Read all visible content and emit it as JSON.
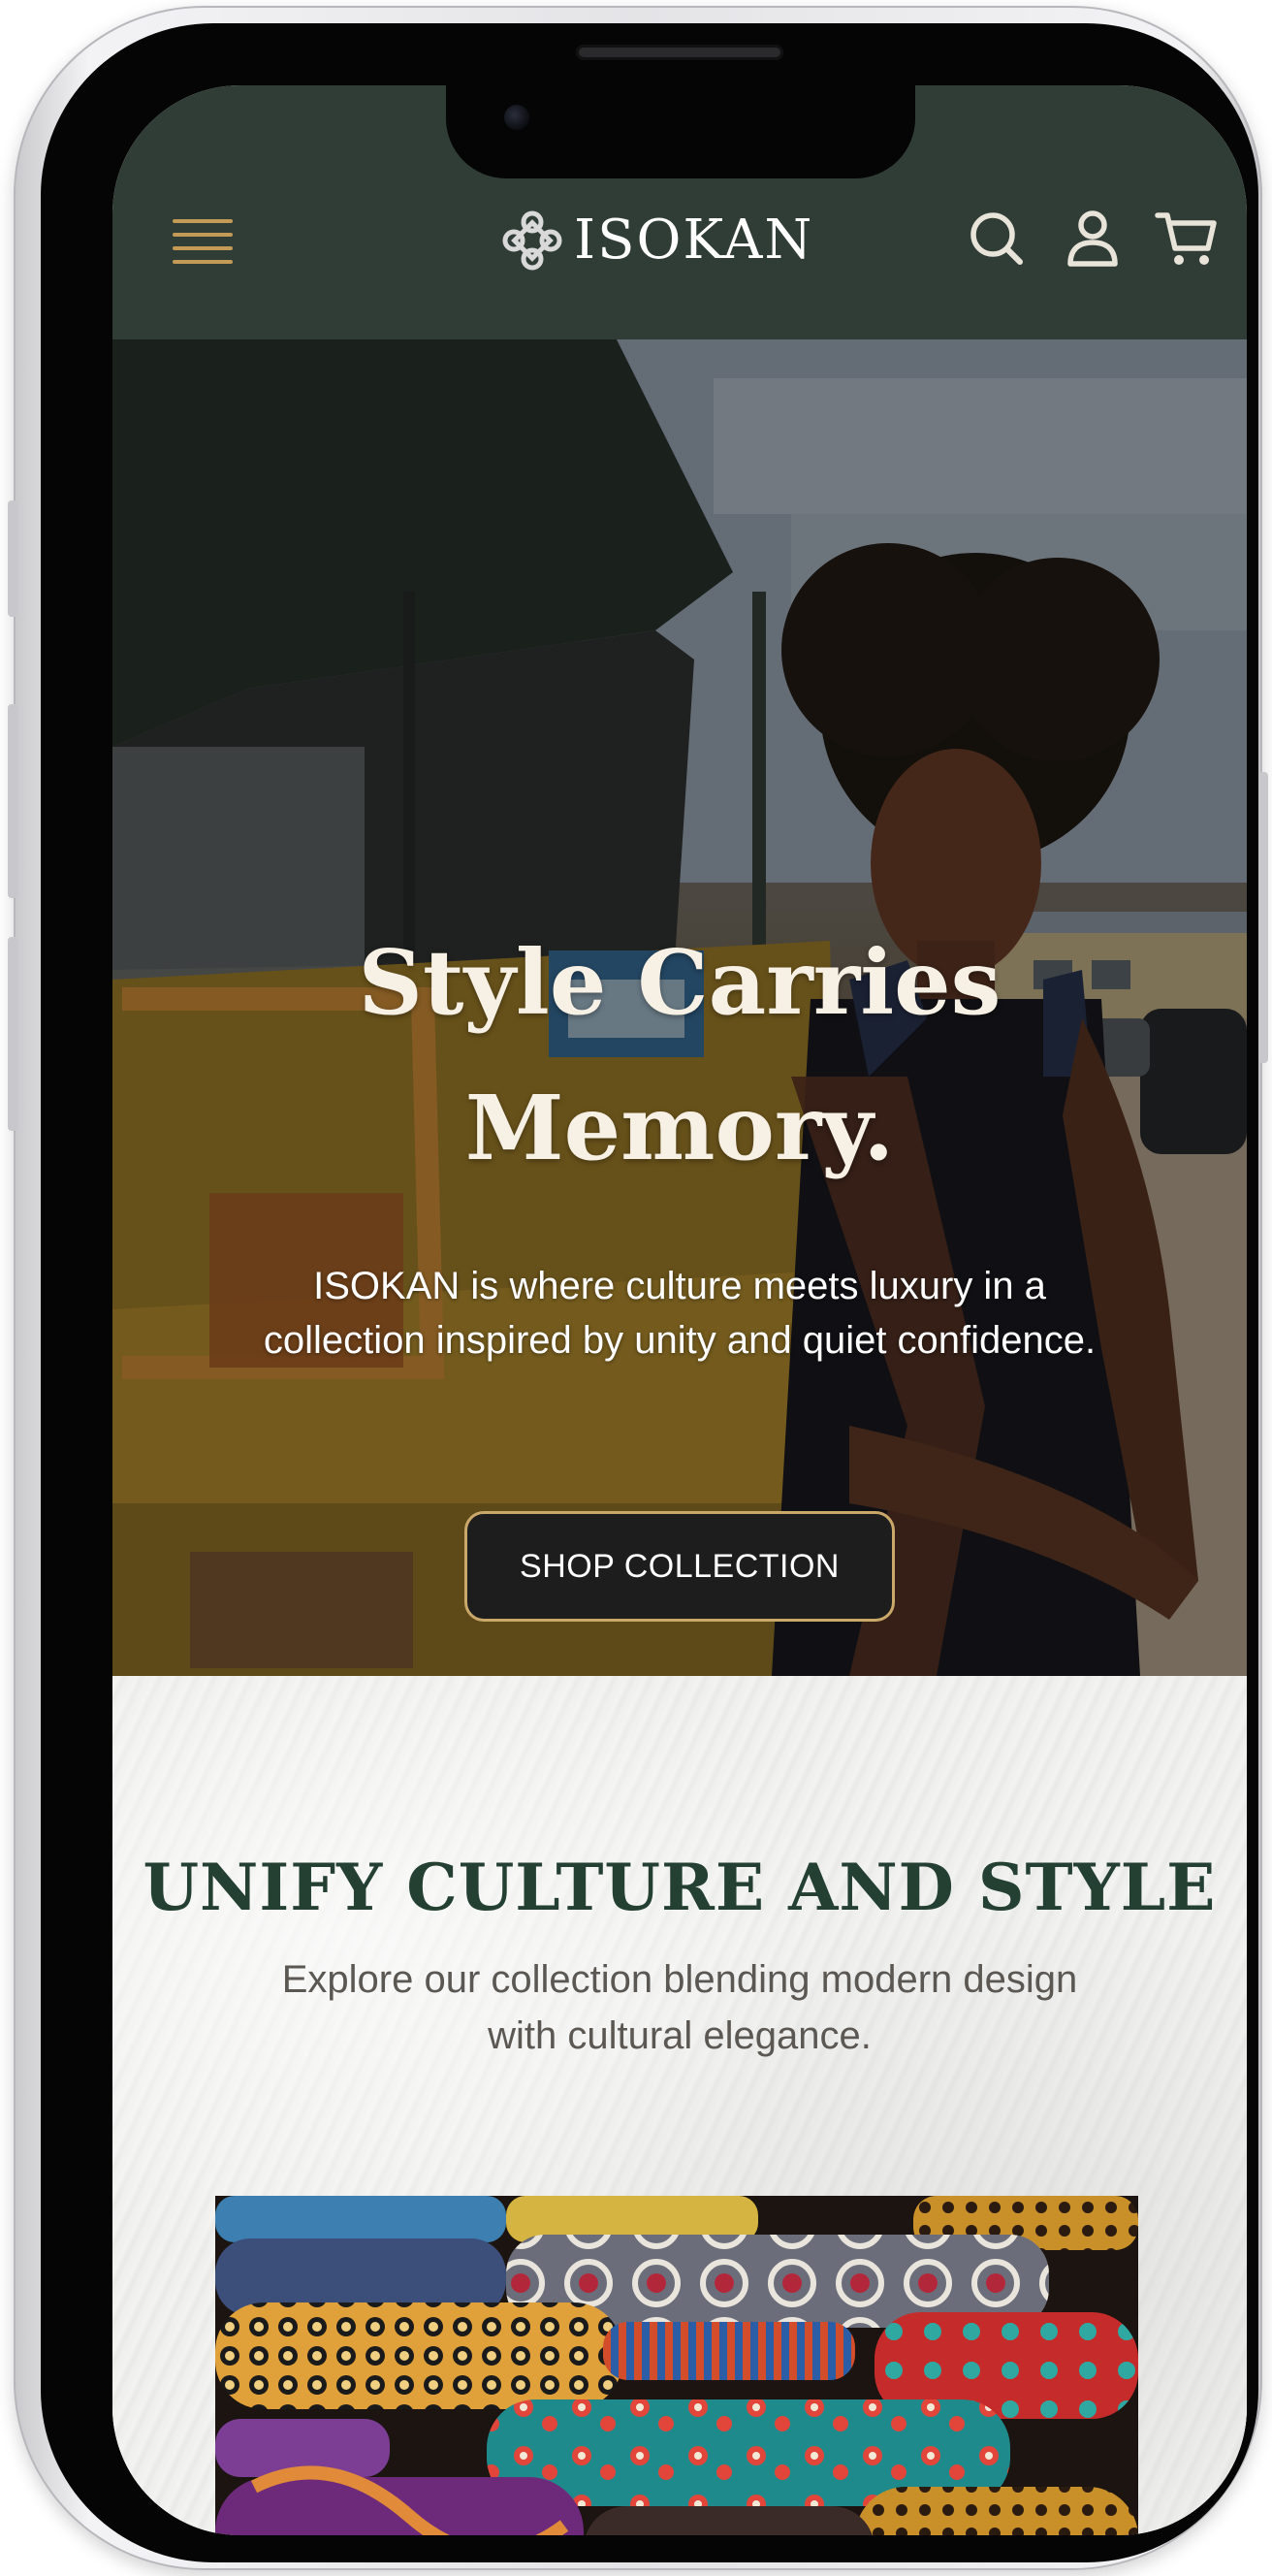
{
  "header": {
    "brand": "ISOKAN",
    "menu_icon": "hamburger-menu-icon",
    "logo_icon": "knot-emblem-icon",
    "search_icon": "search-icon",
    "account_icon": "user-icon",
    "cart_icon": "shopping-cart-icon"
  },
  "hero": {
    "title_line1": "Style Carries",
    "title_line2": "Memory.",
    "subtitle_line1": "ISOKAN is where culture meets luxury in a",
    "subtitle_line2": "collection inspired by unity and quiet confidence.",
    "cta_label": "SHOP COLLECTION"
  },
  "collection": {
    "title": "UNIFY CULTURE AND STYLE",
    "subtitle_line1": "Explore our collection blending modern design",
    "subtitle_line2": "with cultural elegance."
  },
  "colors": {
    "header_bg": "#303d36",
    "accent_gold": "#c49b56",
    "heading_green": "#244033",
    "cta_bg": "#1c1d1c"
  }
}
